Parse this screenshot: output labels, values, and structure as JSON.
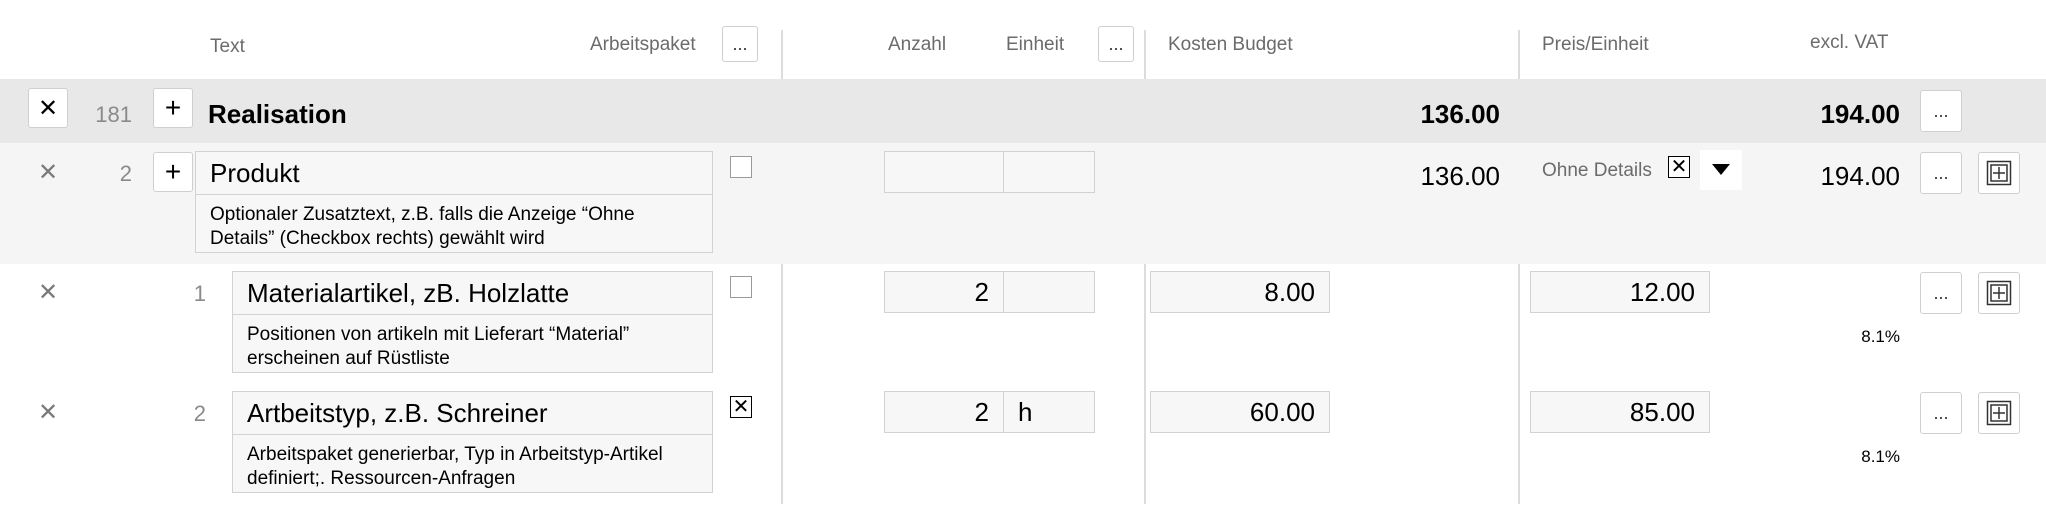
{
  "header": {
    "text": "Text",
    "arbeitspaket": "Arbeitspaket",
    "more": "...",
    "anzahl": "Anzahl",
    "einheit": "Einheit",
    "kosten_budget": "Kosten Budget",
    "preis_einheit": "Preis/Einheit",
    "excl_vat": "excl. VAT"
  },
  "group": {
    "close": "✕",
    "number": "181",
    "add": "+",
    "title": "Realisation",
    "cost": "136.00",
    "total": "194.00",
    "more": "..."
  },
  "product": {
    "close": "✕",
    "number": "2",
    "add": "+",
    "title": "Produkt",
    "note": "Optionaler Zusatztext, z.B. falls die Anzeige “Ohne Details” (Checkbox rechts) gewählt wird",
    "arbeitspaket_checked": false,
    "anzahl": "",
    "einheit": "",
    "cost": "136.00",
    "ohne_details_label": "Ohne Details",
    "ohne_details_checked": true,
    "total": "194.00",
    "more": "..."
  },
  "items": [
    {
      "close": "✕",
      "number": "1",
      "title": "Materialartikel, zB. Holzlatte",
      "note": "Positionen von artikeln mit Lieferart “Material” erscheinen auf Rüstliste",
      "arbeitspaket_checked": false,
      "anzahl": "2",
      "einheit": "",
      "cost": "8.00",
      "price": "12.00",
      "vat": "8.1%",
      "more": "..."
    },
    {
      "close": "✕",
      "number": "2",
      "title": "Artbeitstyp, z.B. Schreiner",
      "note": "Arbeitspaket generierbar, Typ in Arbeitstyp-Artikel definiert;. Ressourcen-Anfragen",
      "arbeitspaket_checked": true,
      "anzahl": "2",
      "einheit": "h",
      "cost": "60.00",
      "price": "85.00",
      "vat": "8.1%",
      "more": "..."
    }
  ]
}
